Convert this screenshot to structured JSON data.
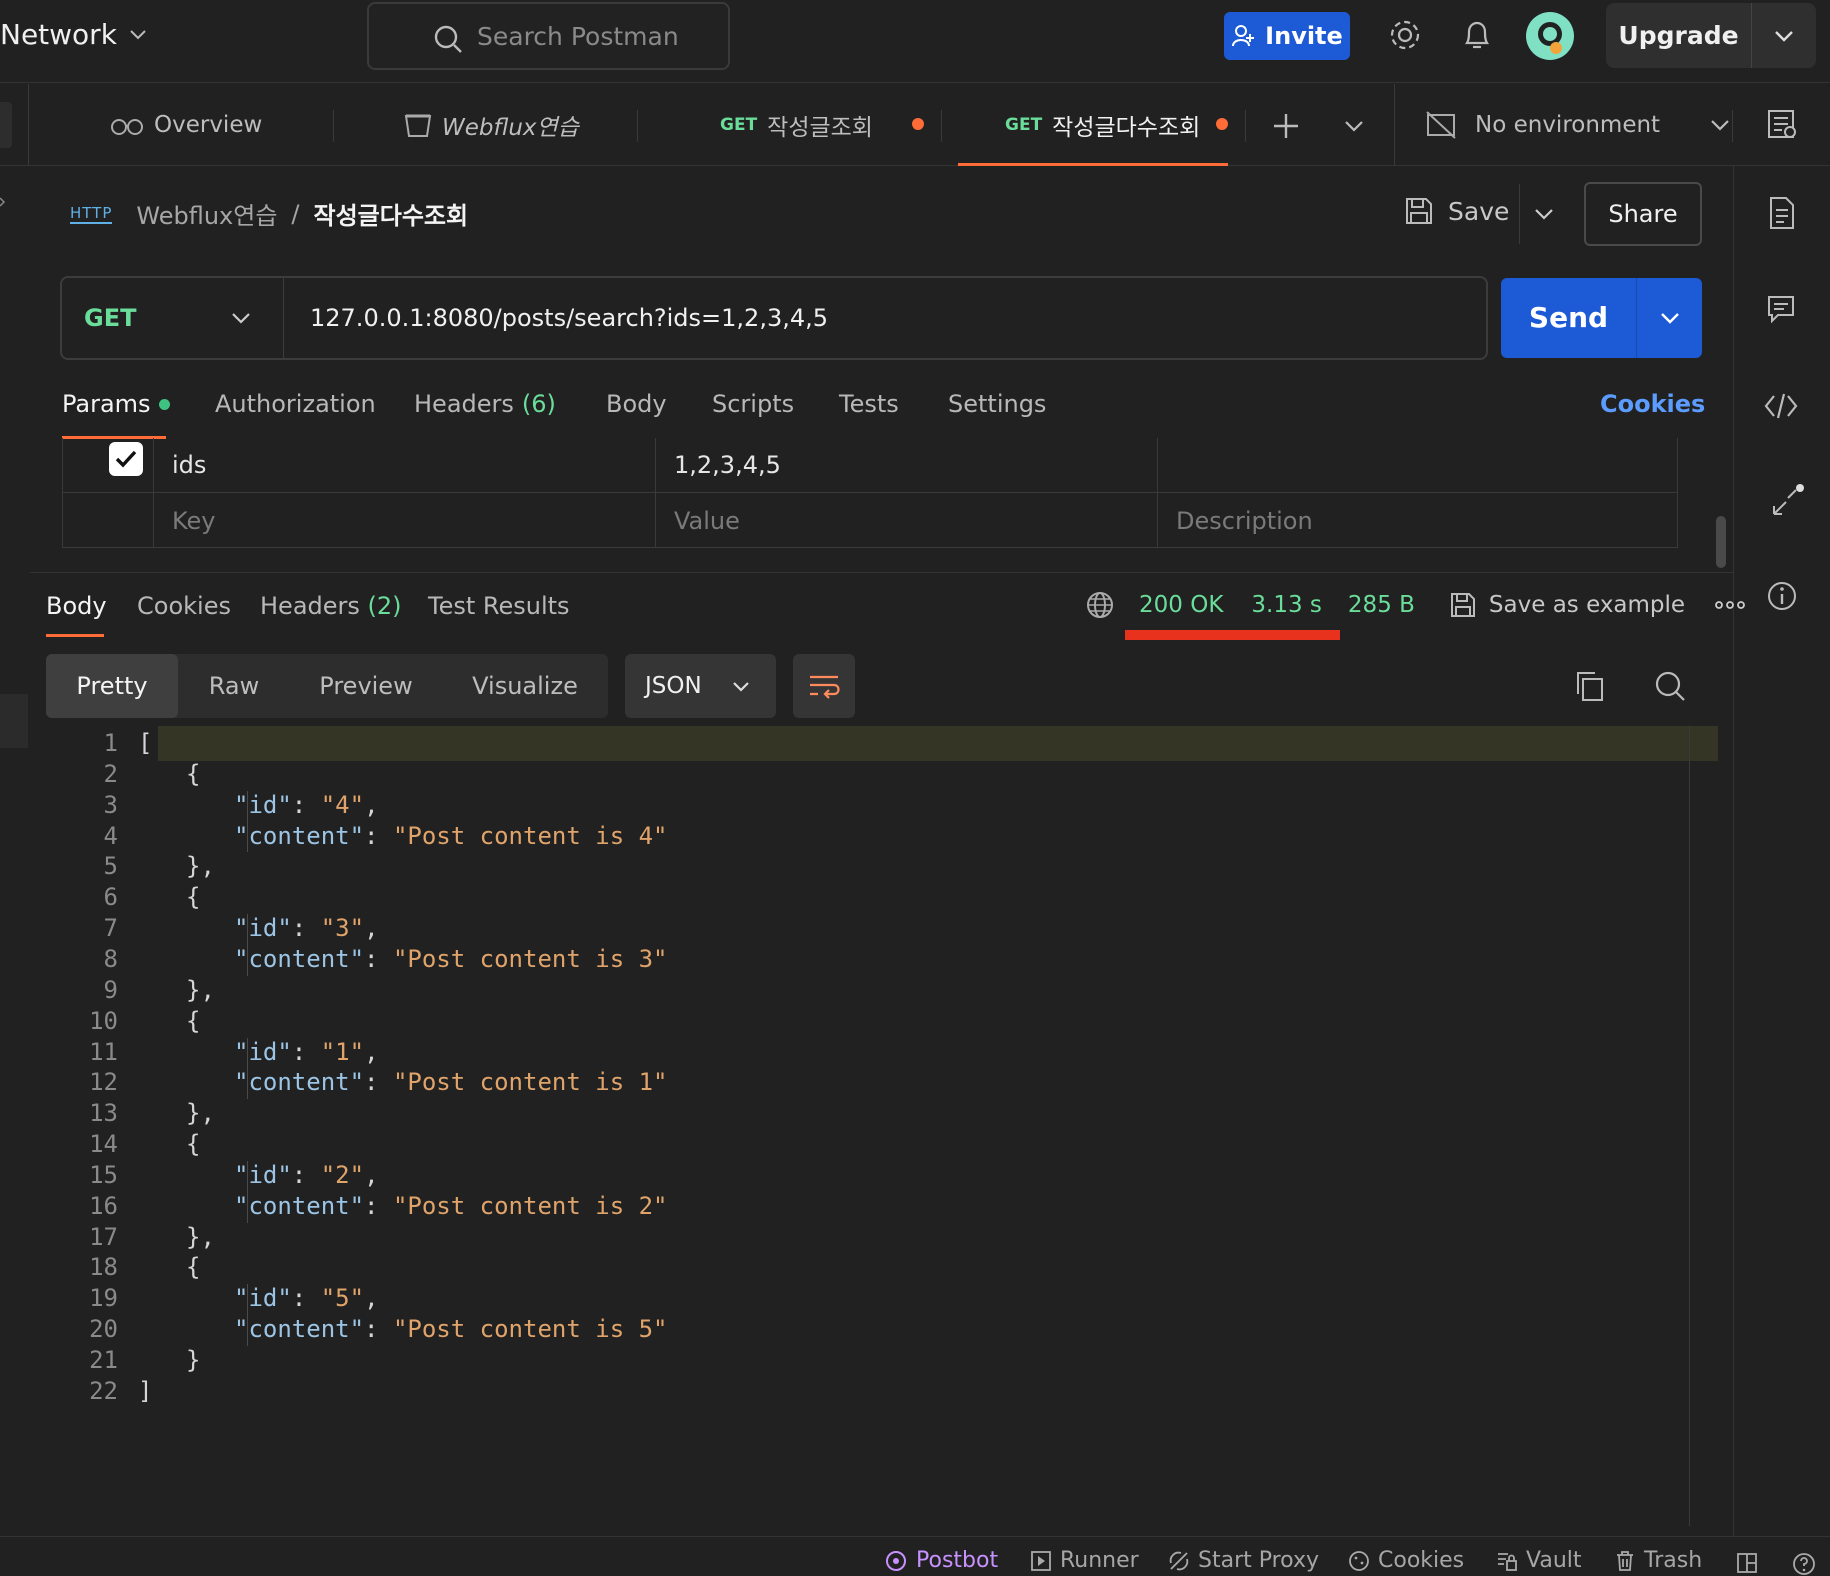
{
  "topbar": {
    "workspace": "Network",
    "search_placeholder": "Search Postman",
    "invite_label": "Invite",
    "upgrade_label": "Upgrade"
  },
  "tabs": [
    {
      "method": "",
      "label": "Overview"
    },
    {
      "method": "",
      "label": "Webflux연습"
    },
    {
      "method": "GET",
      "label": "작성글조회"
    },
    {
      "method": "GET",
      "label": "작성글다수조회"
    }
  ],
  "environment": "No environment",
  "breadcrumb": {
    "badge": "HTTP",
    "parent": "Webflux연습",
    "separator": "/",
    "current": "작성글다수조회"
  },
  "actions": {
    "save_label": "Save",
    "share_label": "Share"
  },
  "request": {
    "method": "GET",
    "url": "127.0.0.1:8080/posts/search?ids=1,2,3,4,5",
    "send_label": "Send"
  },
  "request_tabs": {
    "params": "Params",
    "authorization": "Authorization",
    "headers": "Headers",
    "headers_count": "(6)",
    "body": "Body",
    "scripts": "Scripts",
    "tests": "Tests",
    "settings": "Settings",
    "cookies": "Cookies"
  },
  "params": {
    "row": {
      "key": "ids",
      "value": "1,2,3,4,5",
      "checked": true
    },
    "placeholders": {
      "key": "Key",
      "value": "Value",
      "description": "Description"
    }
  },
  "response_tabs": {
    "body": "Body",
    "cookies": "Cookies",
    "headers": "Headers",
    "headers_count": "(2)",
    "test_results": "Test Results"
  },
  "response_status": {
    "status": "200 OK",
    "time": "3.13 s",
    "size": "285 B",
    "save_example": "Save as example"
  },
  "view_modes": [
    "Pretty",
    "Raw",
    "Preview",
    "Visualize"
  ],
  "format": "JSON",
  "code_lines": [
    "[",
    "{",
    "\"id\": \"4\",",
    "\"content\": \"Post content is 4\"",
    "},",
    "{",
    "\"id\": \"3\",",
    "\"content\": \"Post content is 3\"",
    "},",
    "{",
    "\"id\": \"1\",",
    "\"content\": \"Post content is 1\"",
    "},",
    "{",
    "\"id\": \"2\",",
    "\"content\": \"Post content is 2\"",
    "},",
    "{",
    "\"id\": \"5\",",
    "\"content\": \"Post content is 5\"",
    "}",
    "]"
  ],
  "footer": [
    "Postbot",
    "Runner",
    "Start Proxy",
    "Cookies",
    "Vault",
    "Trash"
  ],
  "colors": {
    "accent": "#1d5bd6",
    "method_get": "#6bdd9a",
    "modified_dot": "#ff6c37",
    "status_underline": "#e8321e"
  }
}
